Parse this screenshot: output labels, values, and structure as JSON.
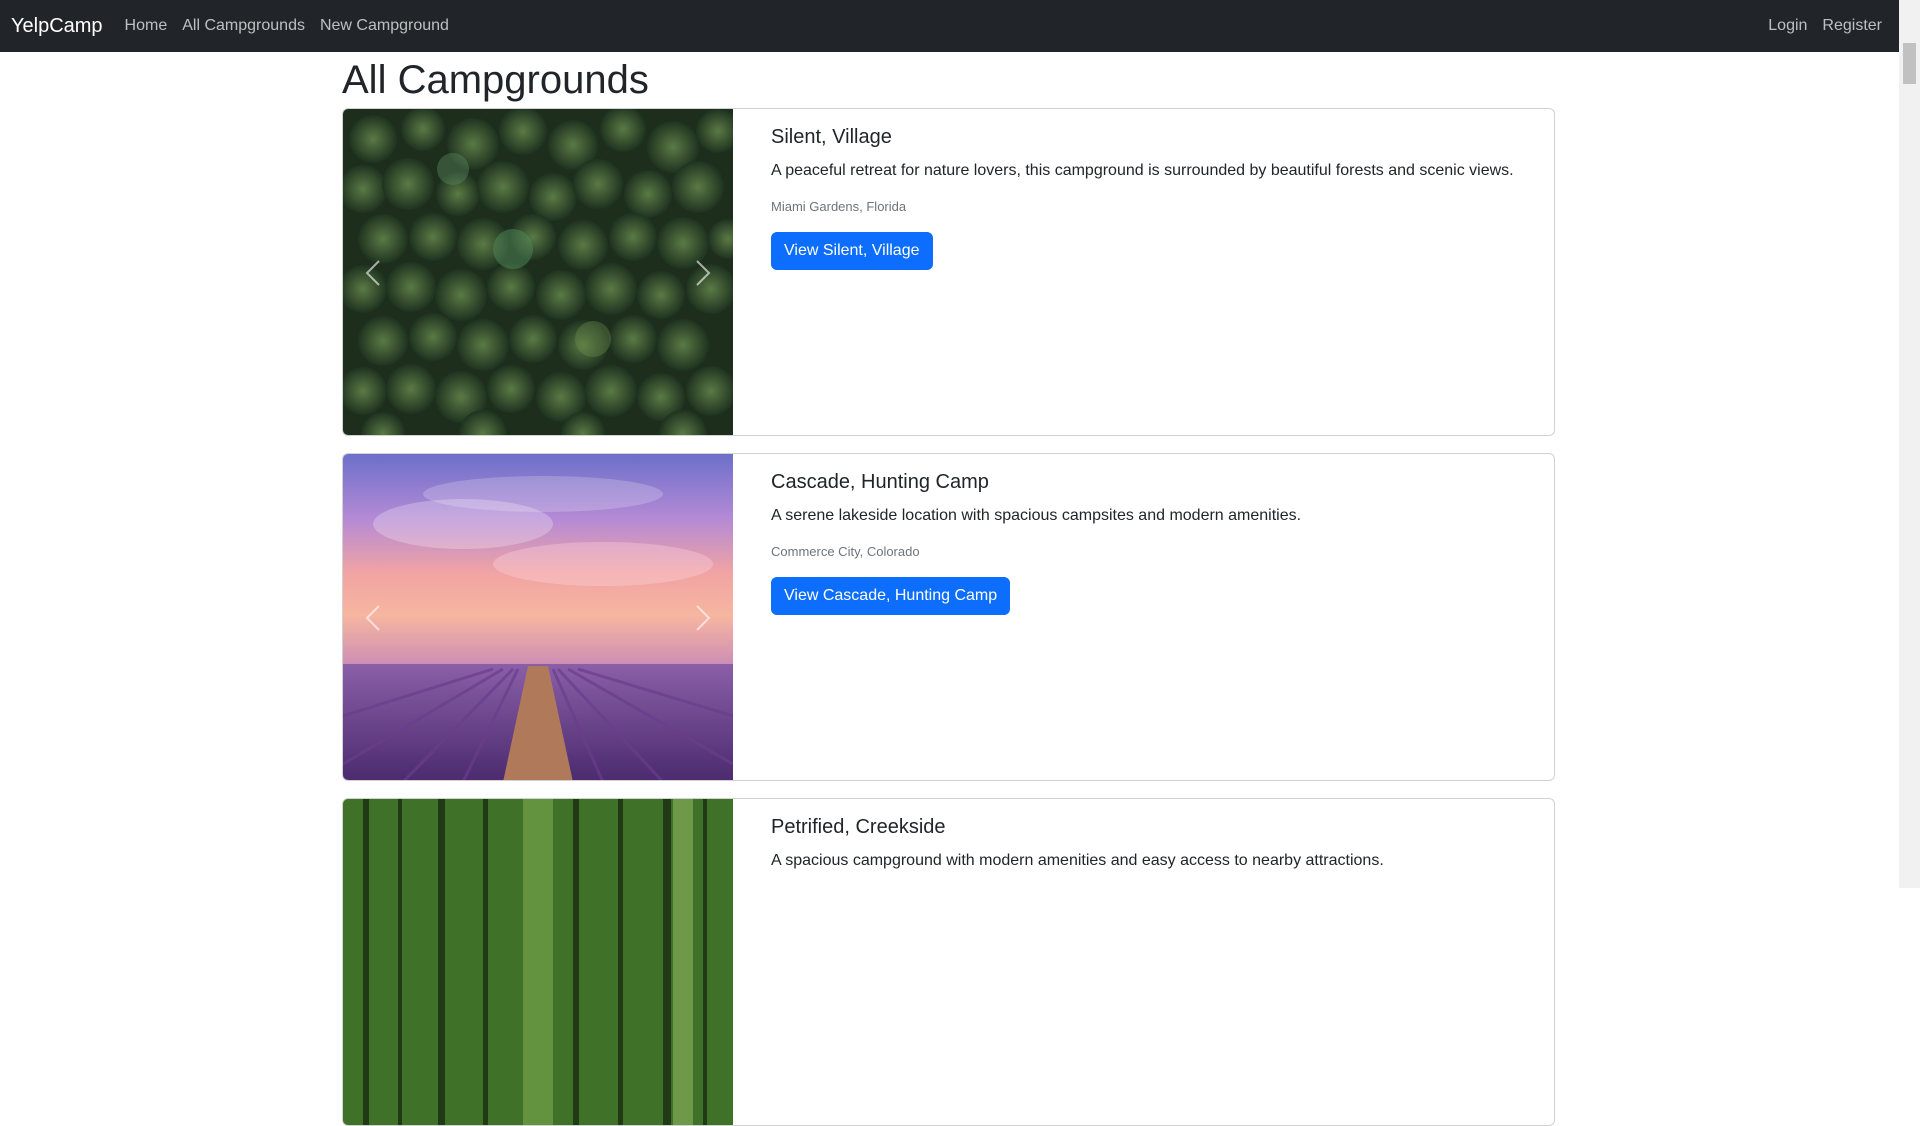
{
  "navbar": {
    "brand": "YelpCamp",
    "links": [
      "Home",
      "All Campgrounds",
      "New Campground"
    ],
    "right_links": [
      "Login",
      "Register"
    ]
  },
  "page": {
    "title": "All Campgrounds"
  },
  "campgrounds": [
    {
      "title": "Silent, Village",
      "description": "A peaceful retreat for nature lovers, this campground is surrounded by beautiful forests and scenic views.",
      "location": "Miami Gardens, Florida",
      "button": "View Silent, Village",
      "image": "forest-aerial-photo"
    },
    {
      "title": "Cascade, Hunting Camp",
      "description": "A serene lakeside location with spacious campsites and modern amenities.",
      "location": "Commerce City, Colorado",
      "button": "View Cascade, Hunting Camp",
      "image": "lavender-field-sunset-photo"
    },
    {
      "title": "Petrified, Creekside",
      "description": "A spacious campground with modern amenities and easy access to nearby attractions.",
      "location": "",
      "button": "",
      "image": "green-forest-path-photo"
    }
  ],
  "colors": {
    "navbar_bg": "#212529",
    "button_primary": "#0d6efd",
    "muted_text": "#6c757d"
  }
}
